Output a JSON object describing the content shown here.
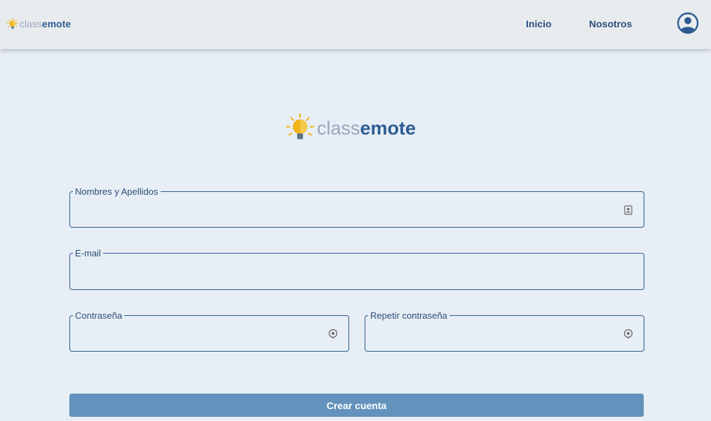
{
  "header": {
    "brand": {
      "part1": "class",
      "part2": "emote",
      "icon": "lightbulb-icon"
    },
    "nav": [
      {
        "label": "Inicio"
      },
      {
        "label": "Nosotros"
      }
    ],
    "account_icon": "account-circle-icon"
  },
  "logo": {
    "part1": "class",
    "part2": "emote",
    "icon": "lightbulb-icon"
  },
  "form": {
    "name": {
      "label": "Nombres y Apellidos",
      "value": "",
      "icon": "contact-card-icon"
    },
    "email": {
      "label": "E-mail",
      "value": ""
    },
    "password": {
      "label": "Contraseña",
      "value": "",
      "icon": "visibility-icon"
    },
    "password_repeat": {
      "label": "Repetir contraseña",
      "value": "",
      "icon": "visibility-icon"
    },
    "submit_label": "Crear cuenta"
  },
  "colors": {
    "background": "#e7eef5",
    "header": "#e8ebee",
    "primary": "#2c5c92",
    "button": "#6393bc",
    "bulb": "#f2b418"
  }
}
